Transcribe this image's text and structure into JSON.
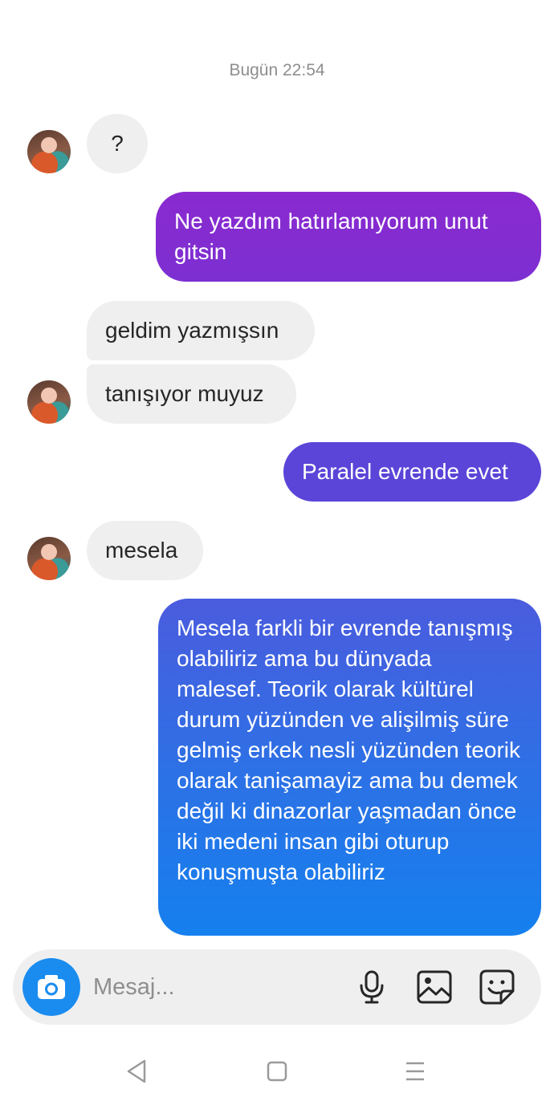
{
  "thread": {
    "timestamp": "Bugün 22:54",
    "messages": [
      {
        "sender": "them",
        "text": "?"
      },
      {
        "sender": "me",
        "text": "Ne yazdım hatırlamıyorum unut gitsin"
      },
      {
        "sender": "them",
        "text": "geldim yazmışsın"
      },
      {
        "sender": "them",
        "text": "tanışıyor muyuz"
      },
      {
        "sender": "me",
        "text": "Paralel evrende evet"
      },
      {
        "sender": "them",
        "text": "mesela"
      },
      {
        "sender": "me",
        "text": "Mesela farkli bir evrende tanışmış olabiliriz ama bu dünyada malesef. Teorik olarak kültürel durum yüzünden ve alişilmiş süre gelmiş erkek nesli yüzünden teorik olarak tanişamayiz ama bu demek değil ki dinazorlar yaşmadan önce iki medeni insan gibi oturup konuşmuşta olabiliriz"
      }
    ]
  },
  "composer": {
    "placeholder": "Mesaj...",
    "icons": [
      "camera-icon",
      "microphone-icon",
      "gallery-icon",
      "sticker-icon"
    ]
  },
  "navbar": {
    "icons": [
      "back-icon",
      "home-icon",
      "menu-icon"
    ]
  },
  "colors": {
    "incoming_bubble": "#efefef",
    "outgoing_purple": "#7c2fd1",
    "outgoing_indigo": "#5a45d8",
    "outgoing_blue": "#1580ee",
    "camera_button": "#1a8cf0"
  }
}
